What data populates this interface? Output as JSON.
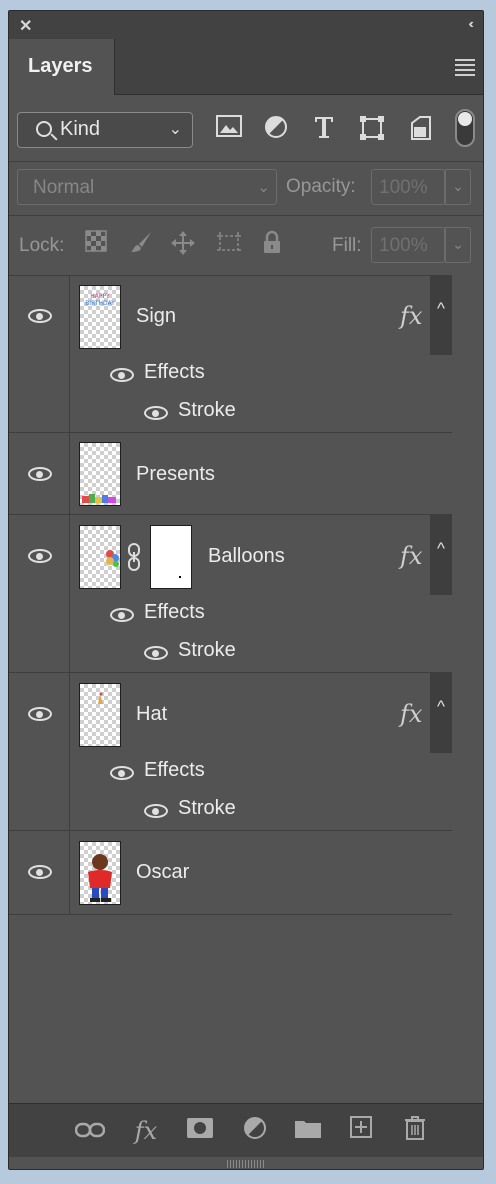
{
  "panel": {
    "tab_label": "Layers",
    "collapse_glyph": "‹‹",
    "close_glyph": "✕"
  },
  "filter": {
    "kind_label": "Kind",
    "icons": [
      "image-filter-icon",
      "adjustment-filter-icon",
      "type-filter-icon",
      "shape-filter-icon",
      "smart-object-filter-icon"
    ]
  },
  "blending": {
    "mode": "Normal",
    "opacity_label": "Opacity:",
    "opacity_value": "100%",
    "fill_label": "Fill:",
    "fill_value": "100%",
    "lock_label": "Lock:"
  },
  "layers": [
    {
      "name": "Sign",
      "fx": "fx",
      "effects_label": "Effects",
      "effect": "Stroke",
      "thumb_text": "HAPPY BIRTHDAY"
    },
    {
      "name": "Presents"
    },
    {
      "name": "Balloons",
      "fx": "fx",
      "effects_label": "Effects",
      "effect": "Stroke"
    },
    {
      "name": "Hat",
      "fx": "fx",
      "effects_label": "Effects",
      "effect": "Stroke"
    },
    {
      "name": "Oscar"
    }
  ],
  "bottom_icons": [
    "link-layers-icon",
    "add-style-icon",
    "add-mask-icon",
    "new-adjustment-icon",
    "new-group-icon",
    "new-layer-icon",
    "delete-layer-icon"
  ],
  "colors": {
    "panel_bg": "#535353",
    "header_bg": "#424242",
    "desktop_bg": "#b7c9dd"
  }
}
